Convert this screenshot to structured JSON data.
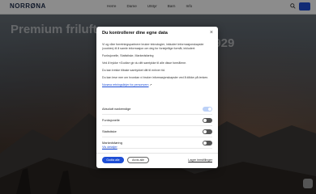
{
  "header": {
    "logo": "NORRØNA",
    "nav": [
      "Herre",
      "Dame",
      "Utstyr",
      "Barn",
      "Info"
    ]
  },
  "hero": {
    "line1": "Premium friluftspr",
    "line2": "1929"
  },
  "modal": {
    "title": "Du kontrollerer dine egne data",
    "close": "×",
    "paragraphs": [
      "Vi og våre forretningspartnere bruker teknologier, inkludert informasjonskapsler (cookies) til å samle informasjon om deg for forskjellige formål, inkludert:",
      "Funksjonelle, Statistiske, Markedsføring",
      "Ved å trykke «Godta» gir du ditt samtykke til alle disse formålene.",
      "Du kan trekke tilbake samtykket ditt til enhver tid.",
      "Du kan lese mer om hvordan vi bruker informasjonskapsler ved å klikke på lenken."
    ],
    "policy_link": "Norøna retningslinjer for personvern",
    "toggles": [
      {
        "label": "Absolutt nødvendige",
        "on": true
      },
      {
        "label": "Funksjonelle",
        "on": false
      },
      {
        "label": "Statistiske",
        "on": false
      },
      {
        "label": "Markedsføring",
        "on": false
      }
    ],
    "details_link": "Vis detaljer",
    "accept_button": "Godta alle",
    "reject_button": "Avvis alle",
    "save_link": "Lagre innstillinger"
  },
  "colors": {
    "accent": "#1f4fd6",
    "toggle_off": "#555555",
    "toggle_on": "#bcd1f7"
  }
}
